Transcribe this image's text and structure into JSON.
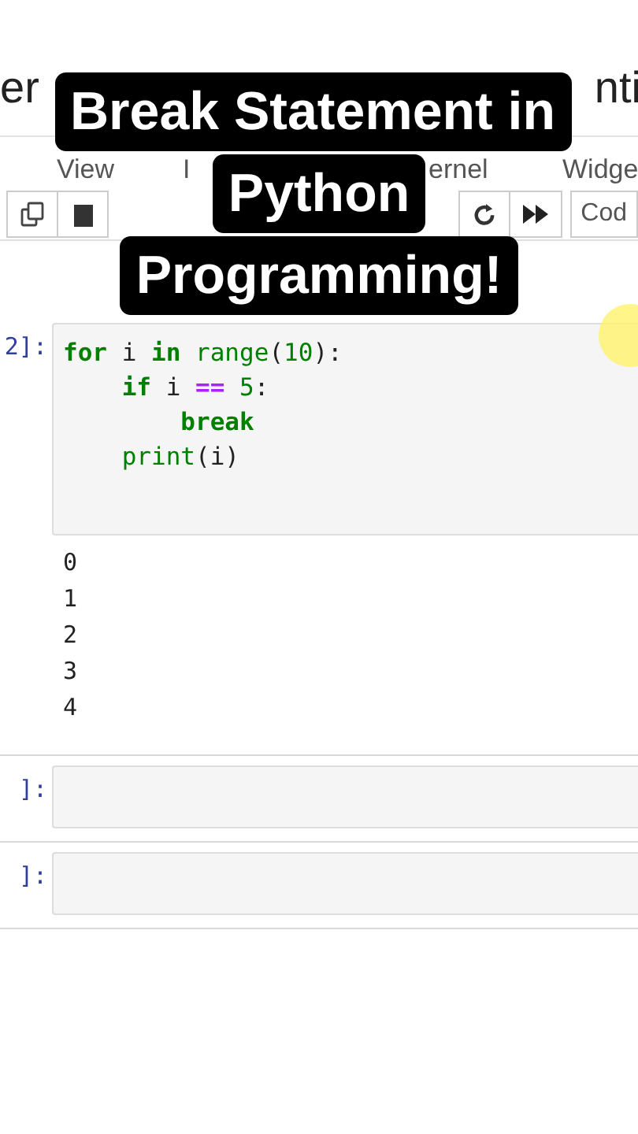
{
  "title_fragments": [
    "er",
    "nti"
  ],
  "menu": [
    {
      "label": "View"
    },
    {
      "label": "I"
    },
    {
      "label": "ernel"
    },
    {
      "label": "Widge"
    }
  ],
  "toolbar": {
    "cell_type": "Cod"
  },
  "cells": [
    {
      "prompt": "2]:",
      "code": [
        "for i in range(10):",
        "    if i == 5:",
        "        break",
        "    print(i)"
      ],
      "output": [
        "0",
        "1",
        "2",
        "3",
        "4"
      ]
    },
    {
      "prompt": "]:"
    },
    {
      "prompt": "]:"
    }
  ],
  "caption": [
    "Break Statement in",
    "Python",
    "Programming!"
  ]
}
